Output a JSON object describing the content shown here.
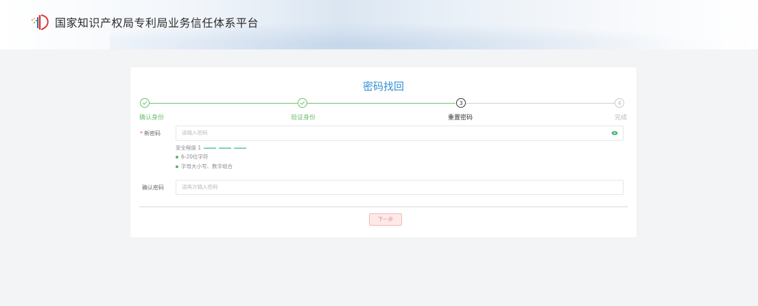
{
  "header": {
    "site_title": "国家知识产权局专利局业务信任体系平台",
    "logo_icon": "cnipa-logo-icon"
  },
  "card": {
    "title": "密码找回"
  },
  "steps": [
    {
      "number": "",
      "label": "确认身份",
      "state": "done"
    },
    {
      "number": "",
      "label": "验证身份",
      "state": "done"
    },
    {
      "number": "3",
      "label": "重置密码",
      "state": "active"
    },
    {
      "number": "4",
      "label": "完成",
      "state": "todo"
    }
  ],
  "form": {
    "new_password": {
      "required_mark": "*",
      "label": "新密码",
      "placeholder": "请输入密码",
      "toggle_icon": "eye-icon"
    },
    "strength": {
      "label": "安全程度 1",
      "level": 1
    },
    "rules": [
      "6-20位字符",
      "字母大小写、数字组合"
    ],
    "confirm_password": {
      "label": "确认密码",
      "placeholder": "请再次输入密码"
    },
    "next_button": "下一步"
  },
  "colors": {
    "accent_blue": "#2f8fd3",
    "done_green": "#6cc06a",
    "button_pink": "#fde9e8",
    "button_text": "#e88a86"
  }
}
